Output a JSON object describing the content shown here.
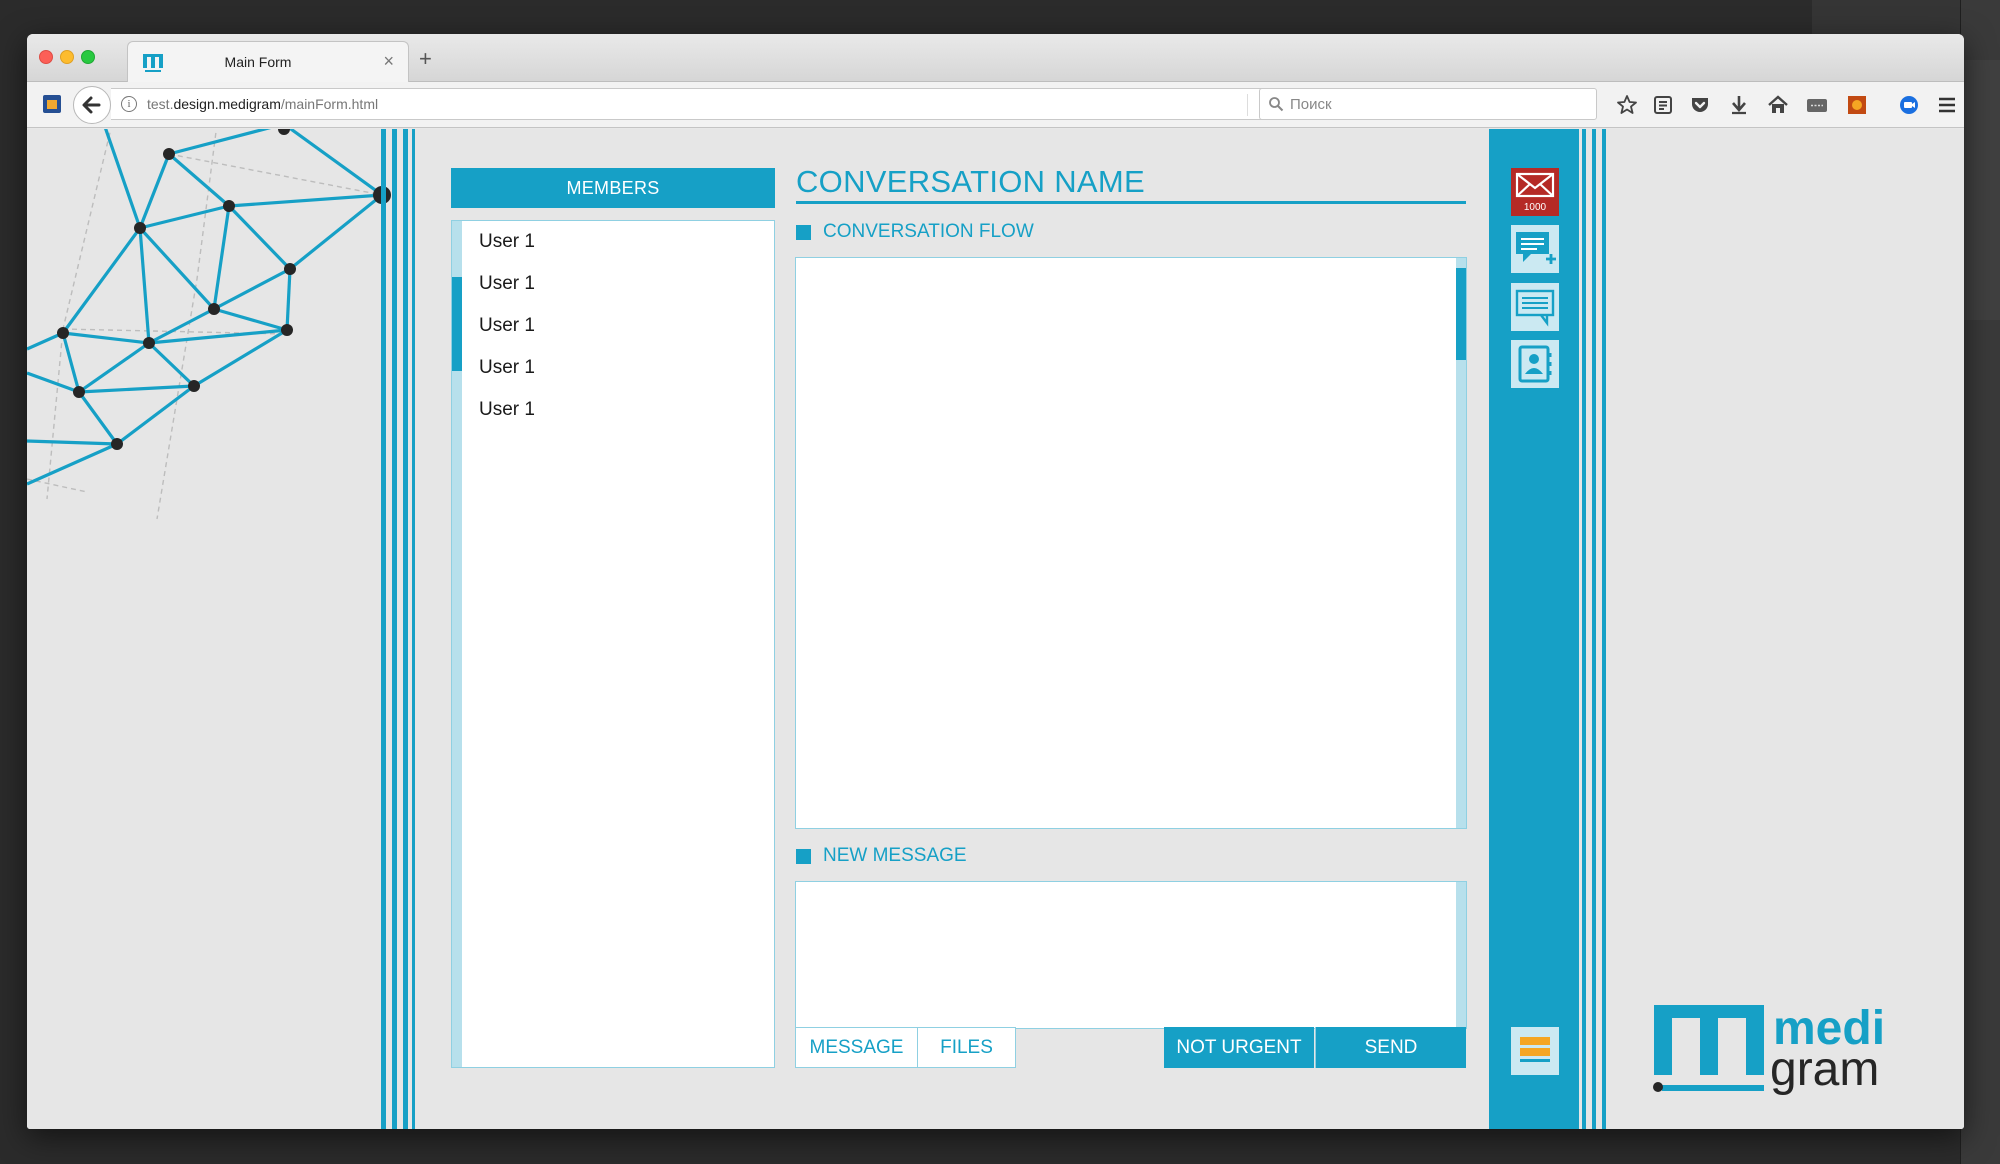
{
  "browser": {
    "tab_title": "Main Form",
    "new_tab_glyph": "+",
    "tab_close_glyph": "×",
    "url_prefix": "test.",
    "url_domain": "design.medigram",
    "url_path": "/mainForm.html",
    "search_placeholder": "Поиск",
    "toolbar_icons": [
      "bookmark-star-icon",
      "reading-list-icon",
      "pocket-icon",
      "download-icon",
      "home-icon",
      "keyboard-extension-icon",
      "extension-orange-icon",
      "screenshot-extension-icon",
      "hamburger-menu-icon"
    ]
  },
  "app": {
    "members_header": "MEMBERS",
    "members": [
      {
        "label": "User 1"
      },
      {
        "label": "User 1"
      },
      {
        "label": "User 1"
      },
      {
        "label": "User 1"
      },
      {
        "label": "User 1"
      }
    ],
    "conversation_title": "CONVERSATION NAME",
    "conversation_flow_label": "CONVERSATION FLOW",
    "new_message_label": "NEW MESSAGE",
    "buttons": {
      "message": "MESSAGE",
      "files": "FILES",
      "not_urgent": "NOT URGENT",
      "send": "SEND"
    },
    "mail_badge": "1000",
    "side_icons": [
      "mail-icon",
      "new-message-icon",
      "chat-icon",
      "contacts-icon"
    ],
    "logo_top": "medi",
    "logo_bottom": "gram"
  },
  "colors": {
    "accent": "#16a0c6",
    "accent_light": "#b7e0ec",
    "mail_red": "#b52a26",
    "page_bg": "#e6e6e6"
  }
}
